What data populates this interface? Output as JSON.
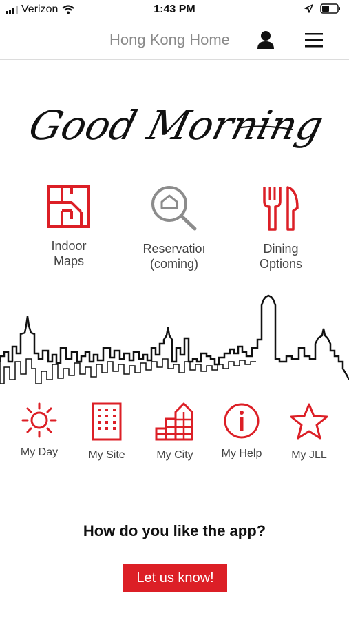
{
  "status_bar": {
    "carrier": "Verizon",
    "time": "1:43 PM",
    "icons": [
      "signal-icon",
      "wifi-icon",
      "location-arrow-icon",
      "battery-icon"
    ]
  },
  "header": {
    "title": "Hong Kong Home",
    "icons": [
      "user-icon",
      "hamburger-menu-icon"
    ]
  },
  "greeting": "Good Morning",
  "features": [
    {
      "label": "Indoor\nMaps",
      "icon": "floor-plan-icon"
    },
    {
      "label": "Reservatioı\n(coming)",
      "icon": "search-house-icon"
    },
    {
      "label": "Dining\nOptions",
      "icon": "fork-knife-icon"
    }
  ],
  "quick_links": [
    {
      "label": "My Day",
      "icon": "sun-icon"
    },
    {
      "label": "My Site",
      "icon": "building-icon"
    },
    {
      "label": "My City",
      "icon": "city-icon"
    },
    {
      "label": "My Help",
      "icon": "info-icon"
    },
    {
      "label": "My JLL",
      "icon": "star-icon"
    }
  ],
  "feedback": {
    "question": "How do you like the app?",
    "button_label": "Let us know!"
  },
  "colors": {
    "accent": "#dc1f26",
    "title_gray": "#8a8a8a",
    "search_icon_gray": "#8c8c8c"
  }
}
